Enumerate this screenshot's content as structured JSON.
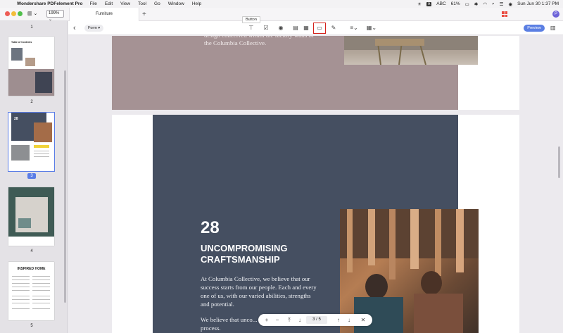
{
  "menubar": {
    "app_name": "Wondershare PDFelement Pro",
    "items": [
      "File",
      "Edit",
      "View",
      "Tool",
      "Go",
      "Window",
      "Help"
    ],
    "input_source": "ABC",
    "battery": "61%",
    "clock": "Sun Jun 30  1:37 PM"
  },
  "tabbar": {
    "zoom": "199%",
    "document_tab": "Furniture",
    "new_tab": "+",
    "user_initial": "P"
  },
  "pages_panel": {
    "page_numbers": [
      "1",
      "2",
      "3",
      "4",
      "5"
    ],
    "thumb2_title": "Table of Contents",
    "thumb3_number": "28",
    "thumb5_title": "INSPIRED HOME"
  },
  "toolbar": {
    "mode": "Form ▾",
    "tooltip": "Button",
    "preview": "Preview"
  },
  "document": {
    "top_text": "design conceived within the factory walls of the Columbia Collective.",
    "section_number": "28",
    "heading": "UNCOMPROMISING CRAFTSMANSHIP",
    "paragraph1": "At Columbia Collective, we believe that our success starts from our people. Each and every one of us, with our varied abilities, strengths and potential.",
    "paragraph2": "We believe that unco... potential is an everyday process."
  },
  "page_nav": {
    "current": "3",
    "separator": "/",
    "total": "5"
  },
  "colors": {
    "accent": "#5b7fe3",
    "highlight": "#d4221c",
    "slate_panel": "#454f61",
    "mauve_panel": "#a59294"
  }
}
